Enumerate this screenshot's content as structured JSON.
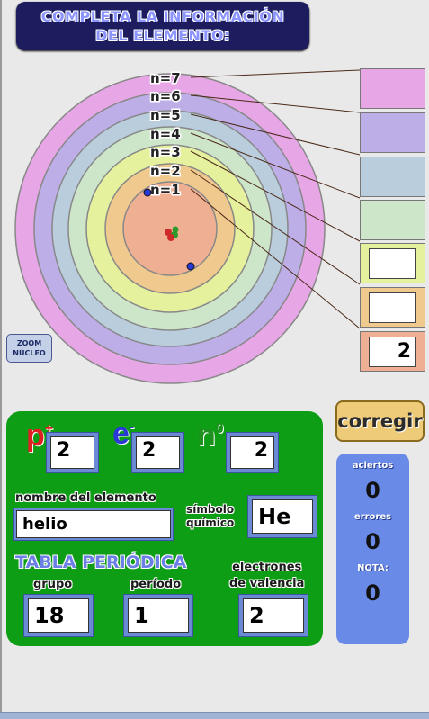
{
  "title": {
    "line1": "COMPLETA LA INFORMACIÓN",
    "line2": "DEL ELEMENTO:"
  },
  "shells": {
    "labels": [
      "n=7",
      "n=6",
      "n=5",
      "n=4",
      "n=3",
      "n=2",
      "n=1"
    ],
    "values": {
      "n1": "2",
      "n2": "",
      "n3": ""
    },
    "colors": [
      "#e7a6e6",
      "#bdaee8",
      "#b9cddd",
      "#cde5c9",
      "#e5f19d",
      "#efc98d",
      "#eeaf93"
    ]
  },
  "zoom_button": {
    "line1": "ZOOM",
    "line2": "NÚCLEO"
  },
  "particles": {
    "proton": {
      "symbol": "p",
      "charge": "+",
      "value": "2",
      "color": "#e02020"
    },
    "electron": {
      "symbol": "e",
      "charge": "-",
      "value": "2",
      "color": "#2b38d8"
    },
    "neutron": {
      "symbol": "n",
      "charge": "0",
      "value": "2",
      "color": "#1f8f1f"
    }
  },
  "element": {
    "name_label": "nombre del elemento",
    "name_value": "helio",
    "symbol_label_1": "símbolo",
    "symbol_label_2": "químico",
    "symbol_value": "He"
  },
  "periodic": {
    "title": "TABLA PERIÓDICA",
    "group_label": "grupo",
    "group_value": "18",
    "period_label": "período",
    "period_value": "1",
    "valence_label_1": "electrones",
    "valence_label_2": "de valencia",
    "valence_value": "2"
  },
  "corregir_button": {
    "label": "corregir"
  },
  "score": {
    "aciertos_label": "aciertos",
    "aciertos_value": "0",
    "errores_label": "errores",
    "errores_value": "0",
    "nota_label": "NOTA:",
    "nota_value": "0"
  }
}
